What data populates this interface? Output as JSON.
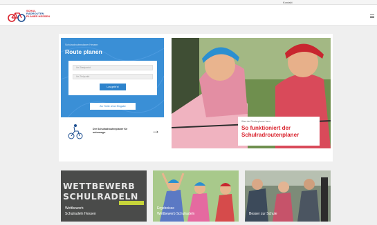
{
  "topbar": {
    "link": "Kontakt"
  },
  "header": {
    "logo_lines": [
      "SCHUL",
      "RADROUTEN",
      "PLANER HESSEN"
    ],
    "menu_icon": "hamburger-menu-icon"
  },
  "route_panel": {
    "overline": "Schulradroutenplaner Hessen",
    "title": "Route planen",
    "start_placeholder": "Ihr Startpunkt",
    "end_placeholder": "Ihr Zielpunkt",
    "submit_label": "Los geht's!",
    "info_label": "Zur Seite ohne Eingabe"
  },
  "promo": {
    "icon": "cyclist-illustration-icon",
    "text": "Der Schulradroutenplaner für unterwegs.",
    "arrow": "→"
  },
  "hero": {
    "overline": "Was der Routenplaner kann",
    "headline": "So funktioniert der Schulradroutenplaner"
  },
  "tiles": [
    {
      "big_line1": "WETTBEWERB",
      "big_line2": "SCHULRADELN",
      "label_line1": "Wettbewerb",
      "label_line2": "Schulradeln Hessen"
    },
    {
      "label_line1": "Ergebnisse",
      "label_line2": "Wettbewerb Schulradeln"
    },
    {
      "label_line1": "Besser zur Schule"
    }
  ],
  "colors": {
    "brand_red": "#d9232d",
    "brand_blue": "#3a8fd6",
    "accent_yellow": "#c6d43a"
  }
}
